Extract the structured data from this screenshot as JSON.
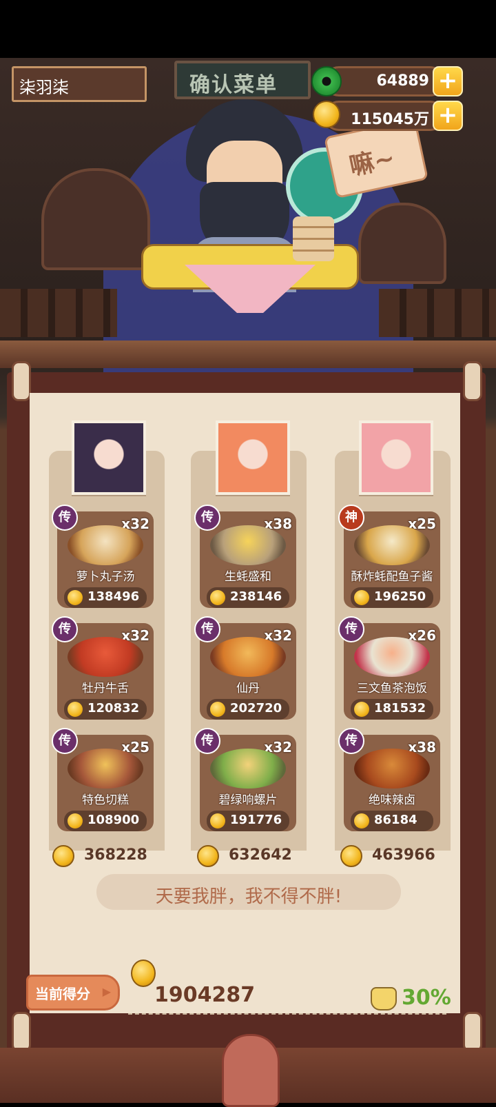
{
  "header": {
    "player_name": "柒羽柒",
    "banner_title": "确认菜单",
    "jade_amount": "64889",
    "coin_amount": "115045万",
    "speech_sign": "嘛~"
  },
  "colors": {
    "jade": "#3bb54a",
    "coin": "#f2b61d",
    "badge_legend": "#6b2f6a",
    "badge_god": "#b83a1e",
    "score_green": "#63a832"
  },
  "columns": [
    {
      "dishes": [
        {
          "badge": "传",
          "qty": "x32",
          "name": "萝卜丸子汤",
          "score": "138496"
        },
        {
          "badge": "传",
          "qty": "x32",
          "name": "牡丹牛舌",
          "score": "120832"
        },
        {
          "badge": "传",
          "qty": "x25",
          "name": "特色切糕",
          "score": "108900"
        }
      ],
      "total": "368228"
    },
    {
      "dishes": [
        {
          "badge": "传",
          "qty": "x38",
          "name": "生蚝盛和",
          "score": "238146"
        },
        {
          "badge": "传",
          "qty": "x32",
          "name": "仙丹",
          "score": "202720"
        },
        {
          "badge": "传",
          "qty": "x32",
          "name": "碧绿响螺片",
          "score": "191776"
        }
      ],
      "total": "632642"
    },
    {
      "dishes": [
        {
          "badge": "神",
          "qty": "x25",
          "name": "酥炸蚝配鱼子酱",
          "score": "196250"
        },
        {
          "badge": "传",
          "qty": "x26",
          "name": "三文鱼茶泡饭",
          "score": "181532"
        },
        {
          "badge": "传",
          "qty": "x38",
          "name": "绝味辣卤",
          "score": "86184"
        }
      ],
      "total": "463966"
    }
  ],
  "comment": "天要我胖，我不得不胖!",
  "footer": {
    "score_label": "当前得分",
    "total_score": "1904287",
    "bonus_percent": "30%"
  }
}
